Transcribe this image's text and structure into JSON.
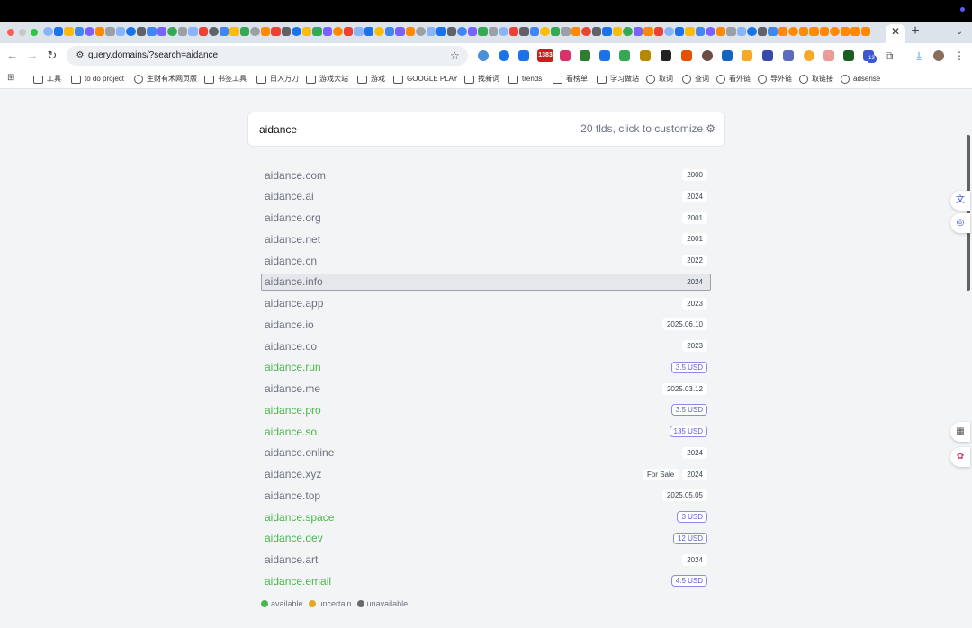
{
  "browser": {
    "address": "query.domains/?search=aidance",
    "ext_badge_text": "1383",
    "ext_count": "13",
    "tab_close": "✕",
    "new_tab": "+",
    "tab_menu": "⌄"
  },
  "bookmarks": [
    {
      "label": "工具",
      "icon": "folder-icon"
    },
    {
      "label": "to do project",
      "icon": "folder-icon"
    },
    {
      "label": "生财有术网页版",
      "icon": "globe-icon"
    },
    {
      "label": "书签工具",
      "icon": "folder-icon"
    },
    {
      "label": "日入万刀",
      "icon": "folder-icon"
    },
    {
      "label": "游戏大站",
      "icon": "folder-icon"
    },
    {
      "label": "游戏",
      "icon": "folder-icon"
    },
    {
      "label": "GOOGLE PLAY",
      "icon": "folder-icon"
    },
    {
      "label": "找新词",
      "icon": "folder-icon"
    },
    {
      "label": "trends",
      "icon": "folder-icon"
    },
    {
      "label": "看榜单",
      "icon": "folder-icon"
    },
    {
      "label": "学习做站",
      "icon": "folder-icon"
    },
    {
      "label": "取词",
      "icon": "globe-icon"
    },
    {
      "label": "查词",
      "icon": "globe-icon"
    },
    {
      "label": "看外链",
      "icon": "globe-icon"
    },
    {
      "label": "导外链",
      "icon": "globe-icon"
    },
    {
      "label": "取链接",
      "icon": "globe-icon"
    },
    {
      "label": "adsense",
      "icon": "globe-icon"
    }
  ],
  "search": {
    "value": "aidance",
    "tld_info": "20 tlds, click to customize"
  },
  "colors": {
    "available": "#4cb64c",
    "uncertain": "#e5a823",
    "unavailable": "#6b6b6b",
    "price_accent": "#5b5bd6"
  },
  "domains": [
    {
      "name": "aidance.com",
      "status": "unavailable",
      "badges": [
        "2000"
      ]
    },
    {
      "name": "aidance.ai",
      "status": "unavailable",
      "badges": [
        "2024"
      ]
    },
    {
      "name": "aidance.org",
      "status": "unavailable",
      "badges": [
        "2001"
      ]
    },
    {
      "name": "aidance.net",
      "status": "unavailable",
      "badges": [
        "2001"
      ]
    },
    {
      "name": "aidance.cn",
      "status": "unavailable",
      "badges": [
        "2022"
      ]
    },
    {
      "name": "aidance.info",
      "status": "unavailable",
      "badges": [
        "2024"
      ],
      "highlighted": true
    },
    {
      "name": "aidance.app",
      "status": "unavailable",
      "badges": [
        "2023"
      ]
    },
    {
      "name": "aidance.io",
      "status": "unavailable",
      "badges": [
        "2025.06.10"
      ]
    },
    {
      "name": "aidance.co",
      "status": "unavailable",
      "badges": [
        "2023"
      ]
    },
    {
      "name": "aidance.run",
      "status": "available",
      "badges": [
        "3.5 USD"
      ]
    },
    {
      "name": "aidance.me",
      "status": "unavailable",
      "badges": [
        "2025.03.12"
      ]
    },
    {
      "name": "aidance.pro",
      "status": "available",
      "badges": [
        "3.5 USD"
      ]
    },
    {
      "name": "aidance.so",
      "status": "available",
      "badges": [
        "135 USD"
      ]
    },
    {
      "name": "aidance.online",
      "status": "unavailable",
      "badges": [
        "2024"
      ]
    },
    {
      "name": "aidance.xyz",
      "status": "unavailable",
      "badges": [
        "For Sale",
        "2024"
      ]
    },
    {
      "name": "aidance.top",
      "status": "unavailable",
      "badges": [
        "2025.05.05"
      ]
    },
    {
      "name": "aidance.space",
      "status": "available",
      "badges": [
        "3 USD"
      ]
    },
    {
      "name": "aidance.dev",
      "status": "available",
      "badges": [
        "12 USD"
      ]
    },
    {
      "name": "aidance.art",
      "status": "unavailable",
      "badges": [
        "2024"
      ]
    },
    {
      "name": "aidance.email",
      "status": "available",
      "badges": [
        "4.5 USD"
      ]
    }
  ],
  "legend": [
    {
      "label": "available",
      "status": "available"
    },
    {
      "label": "uncertain",
      "status": "uncertain"
    },
    {
      "label": "unavailable",
      "status": "unavailable"
    }
  ]
}
